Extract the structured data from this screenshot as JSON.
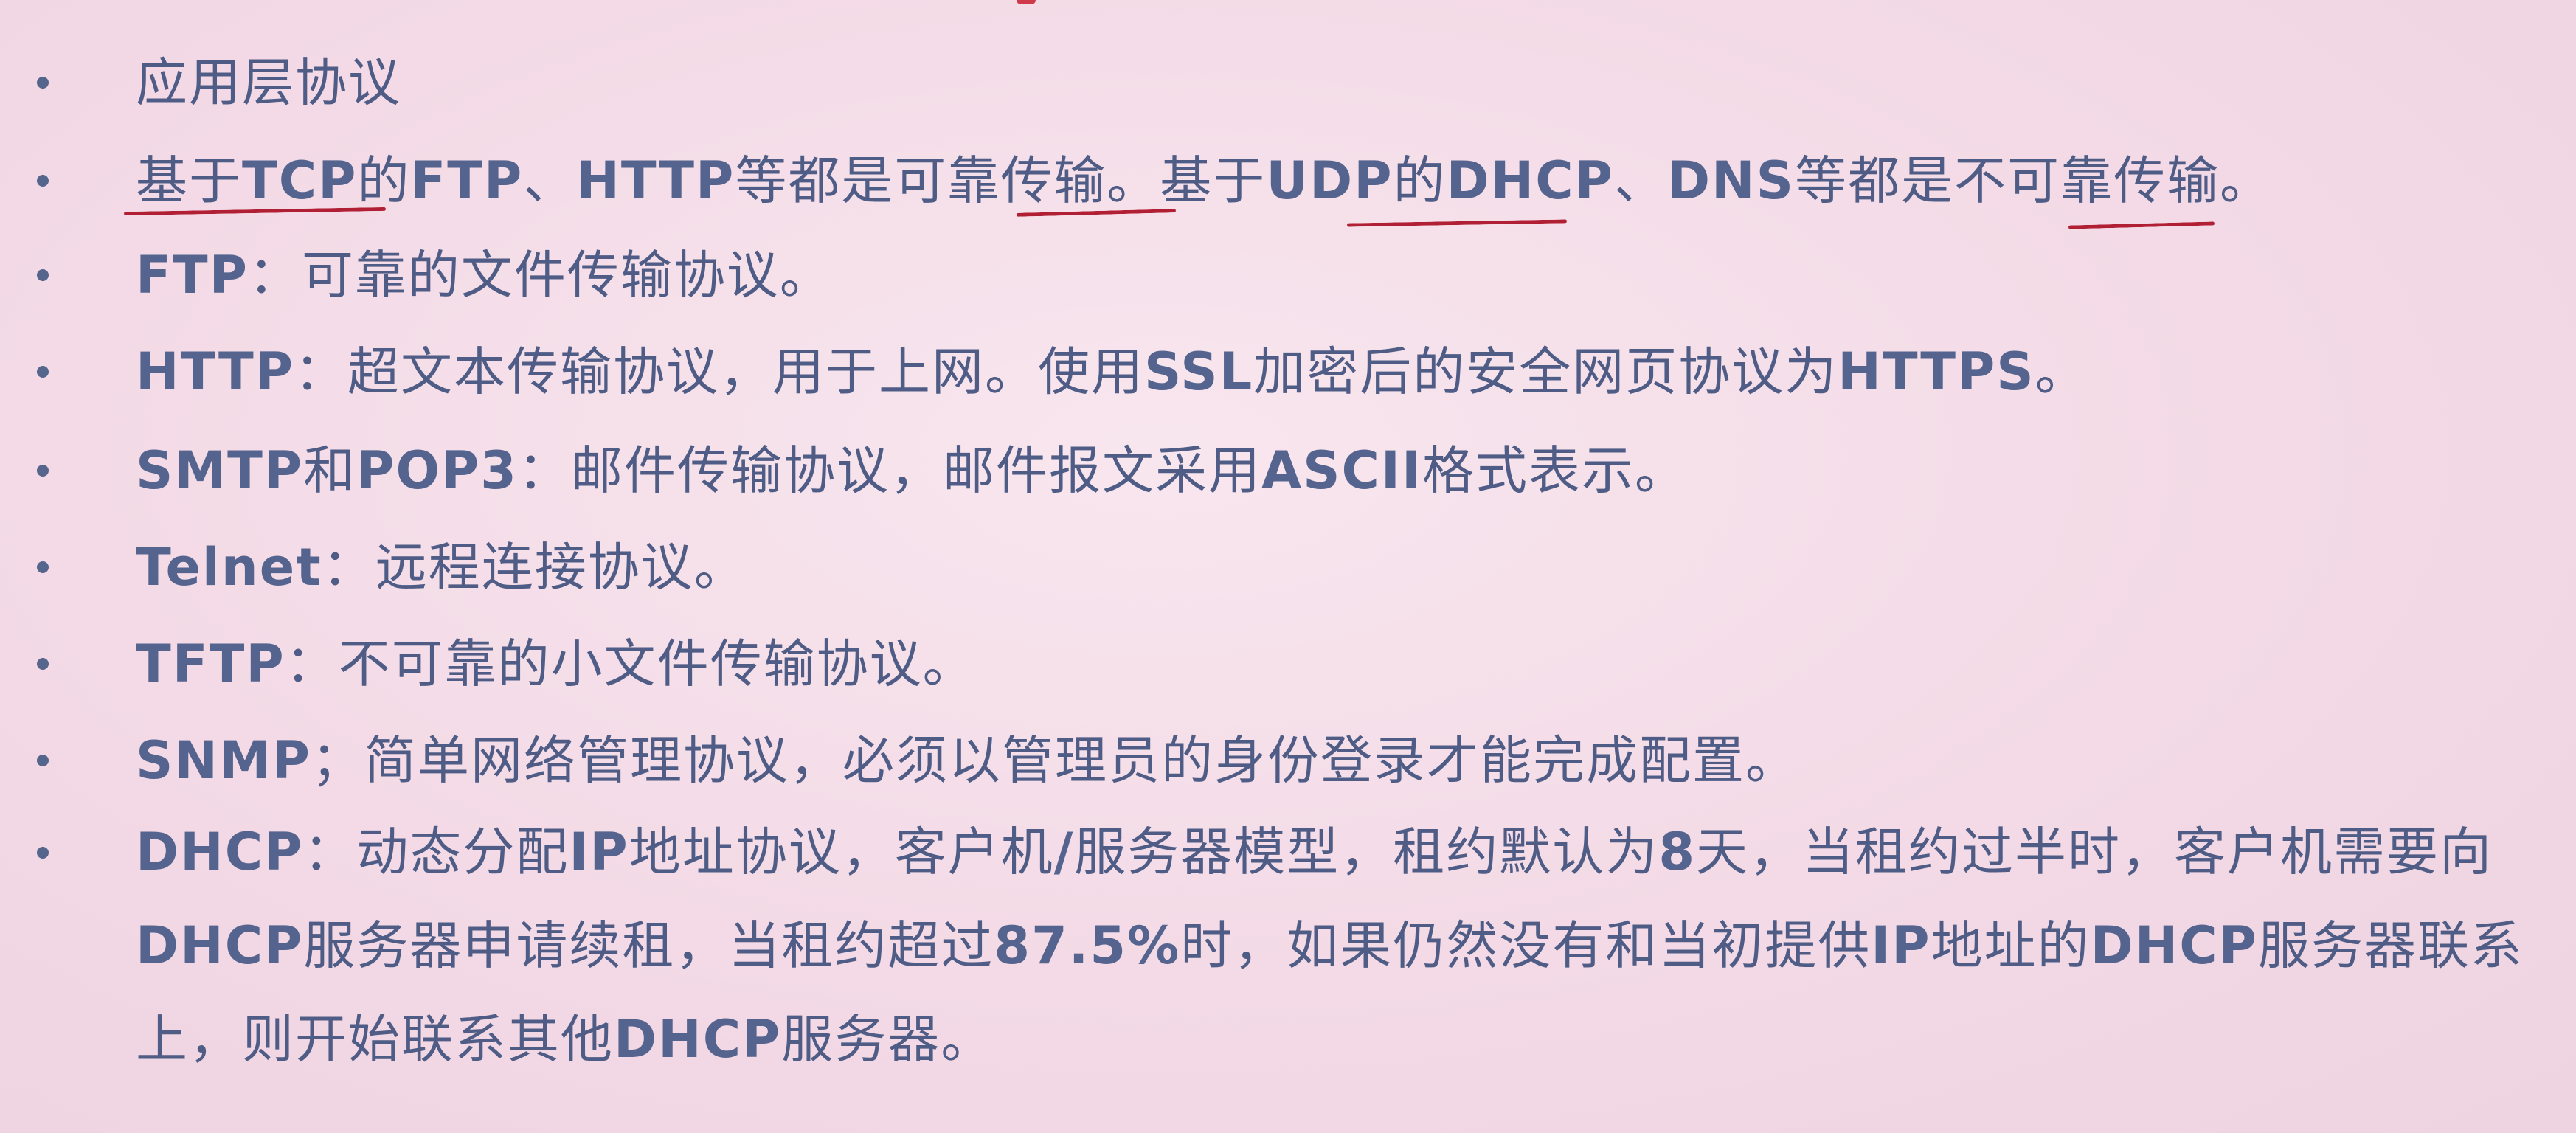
{
  "accent_color": "#4f5d86",
  "underline_color": "#b11f34",
  "items": [
    {
      "text": "应用层协议"
    },
    {
      "text": "基于TCP的FTP、HTTP等都是可靠传输。基于UDP的DHCP、DNS等都是不可靠传输。"
    },
    {
      "text": "FTP：可靠的文件传输协议。"
    },
    {
      "text": "HTTP：超文本传输协议，用于上网。使用SSL加密后的安全网页协议为HTTPS。"
    },
    {
      "text": "SMTP和POP3：邮件传输协议，邮件报文采用ASCII格式表示。"
    },
    {
      "text": "Telnet：远程连接协议。"
    },
    {
      "text": "TFTP：不可靠的小文件传输协议。"
    },
    {
      "text": "SNMP；简单网络管理协议，必须以管理员的身份登录才能完成配置。"
    },
    {
      "text": "DHCP：动态分配IP地址协议，客户机/服务器模型，租约默认为8天，当租约过半时，客户机需要向DHCP服务器申请续租，当租约超过87.5%时，如果仍然没有和当初提供IP地址的DHCP服务器联系上，则开始联系其他DHCP服务器。"
    }
  ]
}
